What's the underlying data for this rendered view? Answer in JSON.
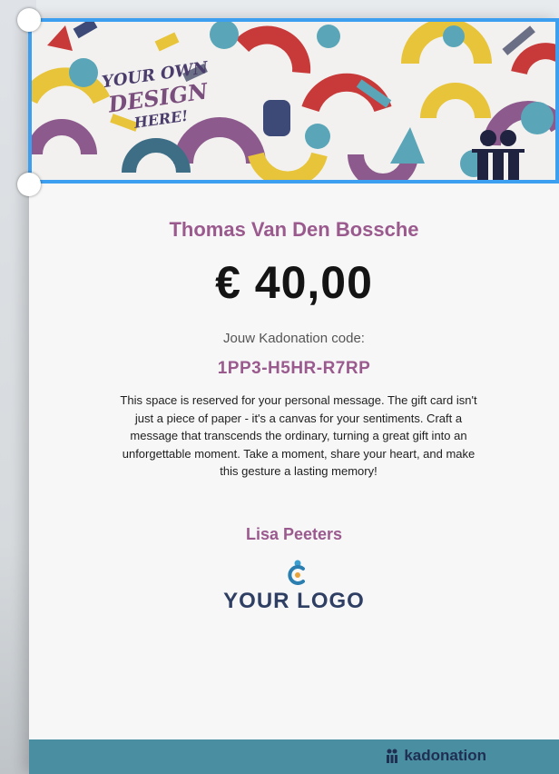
{
  "banner": {
    "design_text_lines": [
      "YOUR OWN",
      "DESIGN",
      "HERE!"
    ]
  },
  "card": {
    "recipient": "Thomas Van Den Bossche",
    "amount": "€ 40,00",
    "code_label": "Jouw Kadonation code:",
    "code": "1PP3-H5HR-R7RP",
    "message": "This space is reserved for your personal message. The gift card isn't just a piece of paper - it's a canvas for your sentiments. Craft a message that transcends the ordinary, turning a great gift into an unforgettable moment. Take a moment, share your heart, and make this gesture a lasting memory!",
    "sender": "Lisa Peeters",
    "logo_text": "YOUR LOGO"
  },
  "footer": {
    "brand": "kadonation"
  },
  "colors": {
    "accent_purple": "#9a5a8e",
    "selection_blue": "#3d9ff0",
    "footer_teal": "#4a8ea2",
    "navy": "#2e3f63"
  },
  "icons": [
    "kadonation-gift-icon",
    "logo-mark-icon"
  ]
}
